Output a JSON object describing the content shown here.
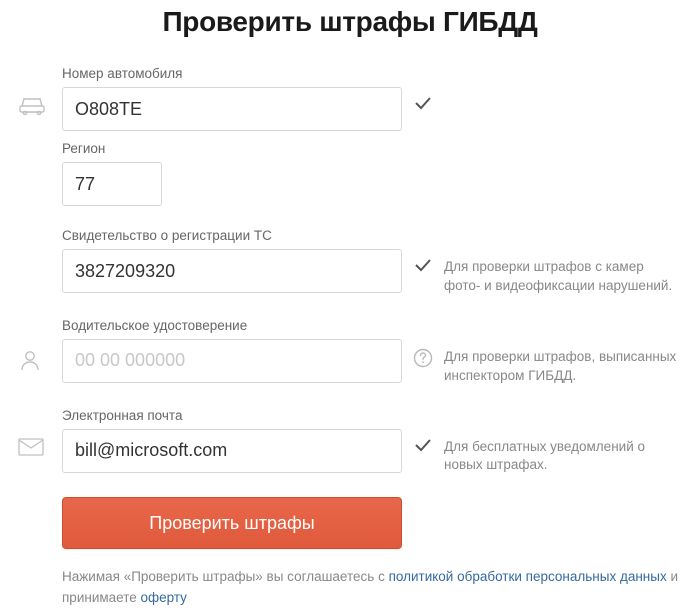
{
  "title": "Проверить штрафы ГИБДД",
  "plate": {
    "number_label": "Номер автомобиля",
    "number_value": "О808ТЕ",
    "region_label": "Регион",
    "region_value": "77"
  },
  "registration": {
    "label": "Свидетельство о регистрации ТС",
    "value": "3827209320",
    "hint": "Для проверки штрафов с камер фото- и видеофиксации нарушений."
  },
  "license": {
    "label": "Водительское удостоверение",
    "value": "",
    "placeholder": "00 00 000000",
    "hint": "Для проверки штрафов, выписанных инспектором ГИБДД."
  },
  "email": {
    "label": "Электронная почта",
    "value": "bill@microsoft.com",
    "hint": "Для бесплатных уведомлений о новых штрафах."
  },
  "submit_label": "Проверить штрафы",
  "disclaimer": {
    "prefix": "Нажимая «Проверить штрафы» вы соглашаетесь с ",
    "link1": "политикой обработки персональных данных",
    "middle": " и принимаете ",
    "link2": "оферту"
  }
}
